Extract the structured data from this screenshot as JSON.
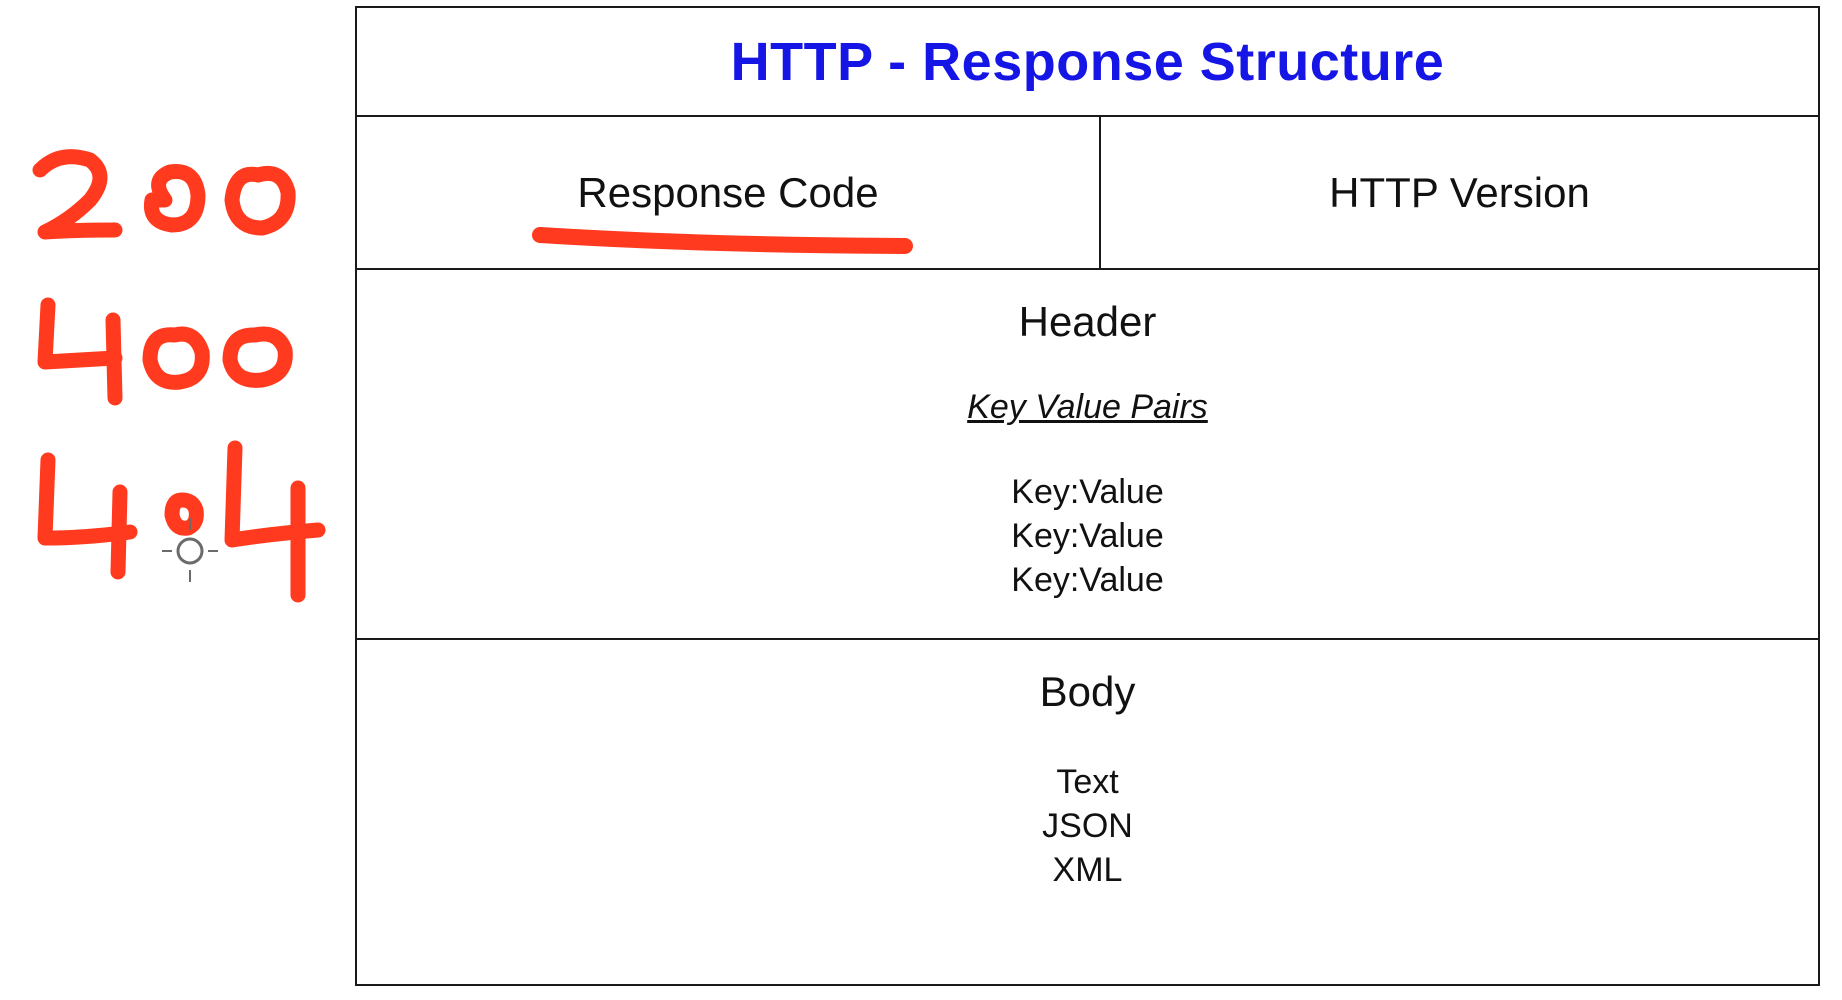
{
  "title": "HTTP - Response Structure",
  "status_line": {
    "left": "Response Code",
    "right": "HTTP Version"
  },
  "header": {
    "title": "Header",
    "subtitle": "Key Value Pairs",
    "lines": [
      "Key:Value",
      "Key:Value",
      "Key:Value"
    ]
  },
  "body": {
    "title": "Body",
    "lines": [
      "Text",
      "JSON",
      "XML"
    ]
  },
  "annotation": {
    "color": "#ff3a1f",
    "handwritten_codes": [
      "200",
      "400",
      "404"
    ]
  }
}
